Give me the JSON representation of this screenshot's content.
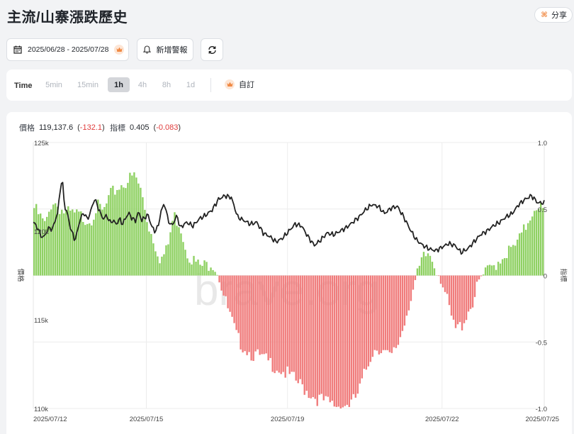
{
  "header": {
    "title": "主流/山寨漲跌歷史",
    "share_label": "分享"
  },
  "toolbar": {
    "date_range": "2025/06/28 - 2025/07/28",
    "alert_label": "新增警報"
  },
  "timeframe": {
    "label": "Time",
    "options": [
      "5min",
      "15min",
      "1h",
      "4h",
      "8h",
      "1d"
    ],
    "selected": "1h",
    "custom_label": "自訂"
  },
  "legend": {
    "price_label": "價格",
    "price_value": "119,137.6",
    "price_change": "-132.1",
    "index_label": "指標",
    "index_value": "0.405",
    "index_change": "-0.083"
  },
  "colors": {
    "positive": "#8fd163",
    "negative": "#f07c7c",
    "price_line": "#222222",
    "accent": "#f08a45"
  },
  "chart_data": {
    "type": "bar+line",
    "x_labels": [
      "2025/07/12",
      "2025/07/15",
      "2025/07/19",
      "2025/07/22",
      "2025/07/25"
    ],
    "x_range": [
      "2025/07/12",
      "2025/07/26"
    ],
    "left_axis": {
      "label": "價格",
      "ticks": [
        "125k",
        "120k",
        "115k",
        "110k"
      ],
      "range": [
        110000,
        125000
      ]
    },
    "right_axis": {
      "label": "指標",
      "ticks": [
        "1.0",
        "0.5",
        "0",
        "-0.5",
        "-1.0"
      ],
      "range": [
        -1.0,
        1.0
      ]
    },
    "watermark": "brave.org",
    "indicator_keypoints": [
      [
        0,
        0.55
      ],
      [
        2,
        0.4
      ],
      [
        3,
        0.6
      ],
      [
        5,
        0.5
      ],
      [
        7,
        0.48
      ],
      [
        9,
        0.45
      ],
      [
        10,
        0.55
      ],
      [
        11,
        0.5
      ],
      [
        12,
        0.62
      ],
      [
        13,
        0.68
      ],
      [
        14,
        0.72
      ],
      [
        15,
        0.75
      ],
      [
        16,
        0.78
      ],
      [
        17,
        0.65
      ],
      [
        18,
        0.42
      ],
      [
        19,
        0.28
      ],
      [
        20,
        0.15
      ],
      [
        21,
        0.22
      ],
      [
        22,
        0.48
      ],
      [
        23,
        0.42
      ],
      [
        24,
        0.22
      ],
      [
        25,
        0.15
      ],
      [
        26,
        0.1
      ],
      [
        27,
        0.1
      ],
      [
        28,
        0.14
      ],
      [
        29,
        0.05
      ],
      [
        30,
        -0.15
      ],
      [
        32,
        -0.45
      ],
      [
        34,
        -0.55
      ],
      [
        36,
        -0.6
      ],
      [
        38,
        -0.65
      ],
      [
        40,
        -0.72
      ],
      [
        42,
        -0.8
      ],
      [
        44,
        -0.88
      ],
      [
        46,
        -0.93
      ],
      [
        48,
        -0.95
      ],
      [
        50,
        -0.93
      ],
      [
        51,
        -0.85
      ],
      [
        52,
        -0.7
      ],
      [
        53,
        -0.55
      ],
      [
        54,
        -0.5
      ],
      [
        55,
        -0.55
      ],
      [
        56,
        -0.6
      ],
      [
        57,
        -0.5
      ],
      [
        58,
        -0.35
      ],
      [
        59,
        -0.15
      ],
      [
        60,
        0.0
      ],
      [
        61,
        0.15
      ],
      [
        62,
        0.2
      ],
      [
        63,
        0.1
      ],
      [
        64,
        0.0
      ],
      [
        65,
        -0.2
      ],
      [
        66,
        -0.38
      ],
      [
        67,
        -0.35
      ],
      [
        68,
        -0.25
      ],
      [
        69,
        -0.15
      ],
      [
        70,
        0.0
      ],
      [
        71,
        0.05
      ],
      [
        72,
        0.1
      ],
      [
        73,
        0.15
      ],
      [
        74,
        0.2
      ],
      [
        75,
        0.22
      ],
      [
        76,
        0.28
      ],
      [
        77,
        0.38
      ],
      [
        78,
        0.5
      ],
      [
        79,
        0.58
      ],
      [
        80,
        0.5
      ]
    ],
    "price_keypoints": [
      [
        0,
        120500
      ],
      [
        0.5,
        120300
      ],
      [
        1,
        119900
      ],
      [
        1.5,
        119600
      ],
      [
        2,
        119900
      ],
      [
        2.5,
        120200
      ],
      [
        3,
        120100
      ],
      [
        3.4,
        120600
      ],
      [
        3.8,
        121000
      ],
      [
        4.2,
        122300
      ],
      [
        4.5,
        123000
      ],
      [
        4.8,
        121800
      ],
      [
        5,
        121300
      ],
      [
        5.4,
        120900
      ],
      [
        5.8,
        120200
      ],
      [
        6.2,
        119800
      ],
      [
        6.5,
        119500
      ],
      [
        6.8,
        119800
      ],
      [
        7,
        120200
      ],
      [
        7.3,
        120600
      ],
      [
        7.6,
        120900
      ],
      [
        8,
        121000
      ],
      [
        8.4,
        120700
      ],
      [
        8.8,
        120900
      ],
      [
        9.2,
        121400
      ],
      [
        9.6,
        121800
      ],
      [
        10,
        121500
      ],
      [
        10.5,
        121000
      ],
      [
        11,
        120700
      ],
      [
        11.5,
        120900
      ],
      [
        12,
        120500
      ],
      [
        12.5,
        120600
      ],
      [
        13,
        120400
      ],
      [
        13.5,
        120700
      ],
      [
        14,
        120400
      ],
      [
        14.5,
        120800
      ],
      [
        15,
        121000
      ],
      [
        15.5,
        120700
      ],
      [
        16,
        120600
      ],
      [
        16.5,
        121100
      ],
      [
        17,
        120600
      ],
      [
        17.5,
        120800
      ],
      [
        18,
        120900
      ],
      [
        18.5,
        120300
      ],
      [
        19,
        120000
      ],
      [
        19.5,
        120200
      ],
      [
        20,
        121100
      ],
      [
        20.5,
        121600
      ],
      [
        21,
        120800
      ],
      [
        21.5,
        120300
      ],
      [
        22,
        120500
      ],
      [
        22.5,
        120900
      ],
      [
        23,
        120200
      ],
      [
        24,
        120500
      ],
      [
        25,
        120300
      ],
      [
        26,
        120700
      ],
      [
        27,
        120900
      ],
      [
        28,
        121200
      ],
      [
        29,
        121800
      ],
      [
        30,
        122000
      ],
      [
        31,
        121900
      ],
      [
        32,
        120800
      ],
      [
        33,
        120600
      ],
      [
        34,
        120400
      ],
      [
        35,
        120500
      ],
      [
        36,
        119900
      ],
      [
        37,
        119700
      ],
      [
        38,
        119400
      ],
      [
        39,
        119600
      ],
      [
        40,
        120000
      ],
      [
        41,
        120400
      ],
      [
        42,
        120300
      ],
      [
        43,
        119700
      ],
      [
        44,
        119200
      ],
      [
        45,
        119500
      ],
      [
        46,
        119900
      ],
      [
        47,
        119800
      ],
      [
        48,
        120000
      ],
      [
        49,
        120200
      ],
      [
        50,
        120500
      ],
      [
        51,
        120800
      ],
      [
        52,
        121200
      ],
      [
        53,
        121500
      ],
      [
        54,
        121400
      ],
      [
        55,
        121000
      ],
      [
        56,
        121300
      ],
      [
        57,
        121400
      ],
      [
        58,
        120800
      ],
      [
        59,
        120100
      ],
      [
        60,
        119500
      ],
      [
        61,
        119200
      ],
      [
        62,
        119000
      ],
      [
        63,
        118900
      ],
      [
        64,
        119100
      ],
      [
        65,
        119300
      ],
      [
        66,
        119200
      ],
      [
        67,
        118800
      ],
      [
        68,
        119000
      ],
      [
        69,
        119400
      ],
      [
        70,
        119800
      ],
      [
        71,
        120000
      ],
      [
        72,
        120300
      ],
      [
        73,
        120500
      ],
      [
        74,
        120800
      ],
      [
        75,
        121000
      ],
      [
        76,
        121500
      ],
      [
        77,
        121800
      ],
      [
        78,
        122000
      ],
      [
        79,
        121600
      ],
      [
        80,
        121600
      ]
    ],
    "keypoint_span": 80
  }
}
